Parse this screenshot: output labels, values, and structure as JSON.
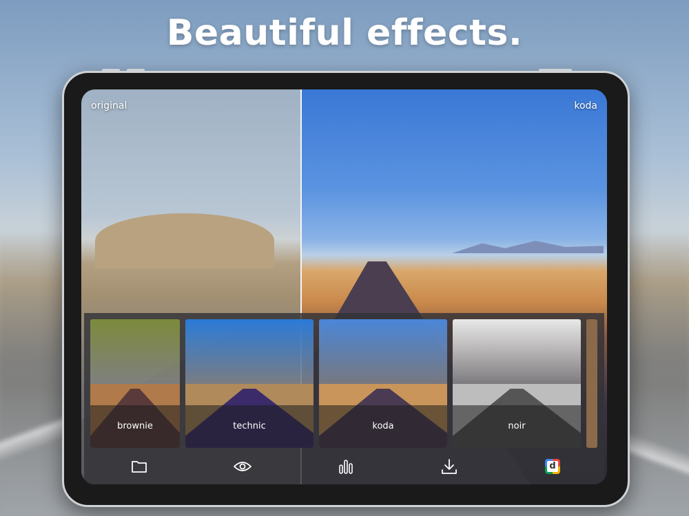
{
  "headline": "Beautiful effects.",
  "compare": {
    "left_label": "original",
    "right_label": "koda"
  },
  "filters": [
    {
      "label": "brownie",
      "sky": "#7c8a3c",
      "land": "#b07a4a",
      "road": "#5a3a3a"
    },
    {
      "label": "technic",
      "sky": "#2a7ad8",
      "land": "#b08a5a",
      "road": "#3b2b6a"
    },
    {
      "label": "koda",
      "sky": "#4a86d8",
      "land": "#c9955a",
      "road": "#4a3a52"
    },
    {
      "label": "noir",
      "sky": "#e8e8e8",
      "land": "#bdbdbd",
      "road": "#555555"
    }
  ],
  "toolbar": {
    "items": [
      "folder-icon",
      "eye-icon",
      "histogram-icon",
      "download-icon",
      "app-logo-icon"
    ],
    "app_logo_letter": "d"
  },
  "colors": {
    "accent": "#ffffff",
    "panel": "#323237"
  }
}
